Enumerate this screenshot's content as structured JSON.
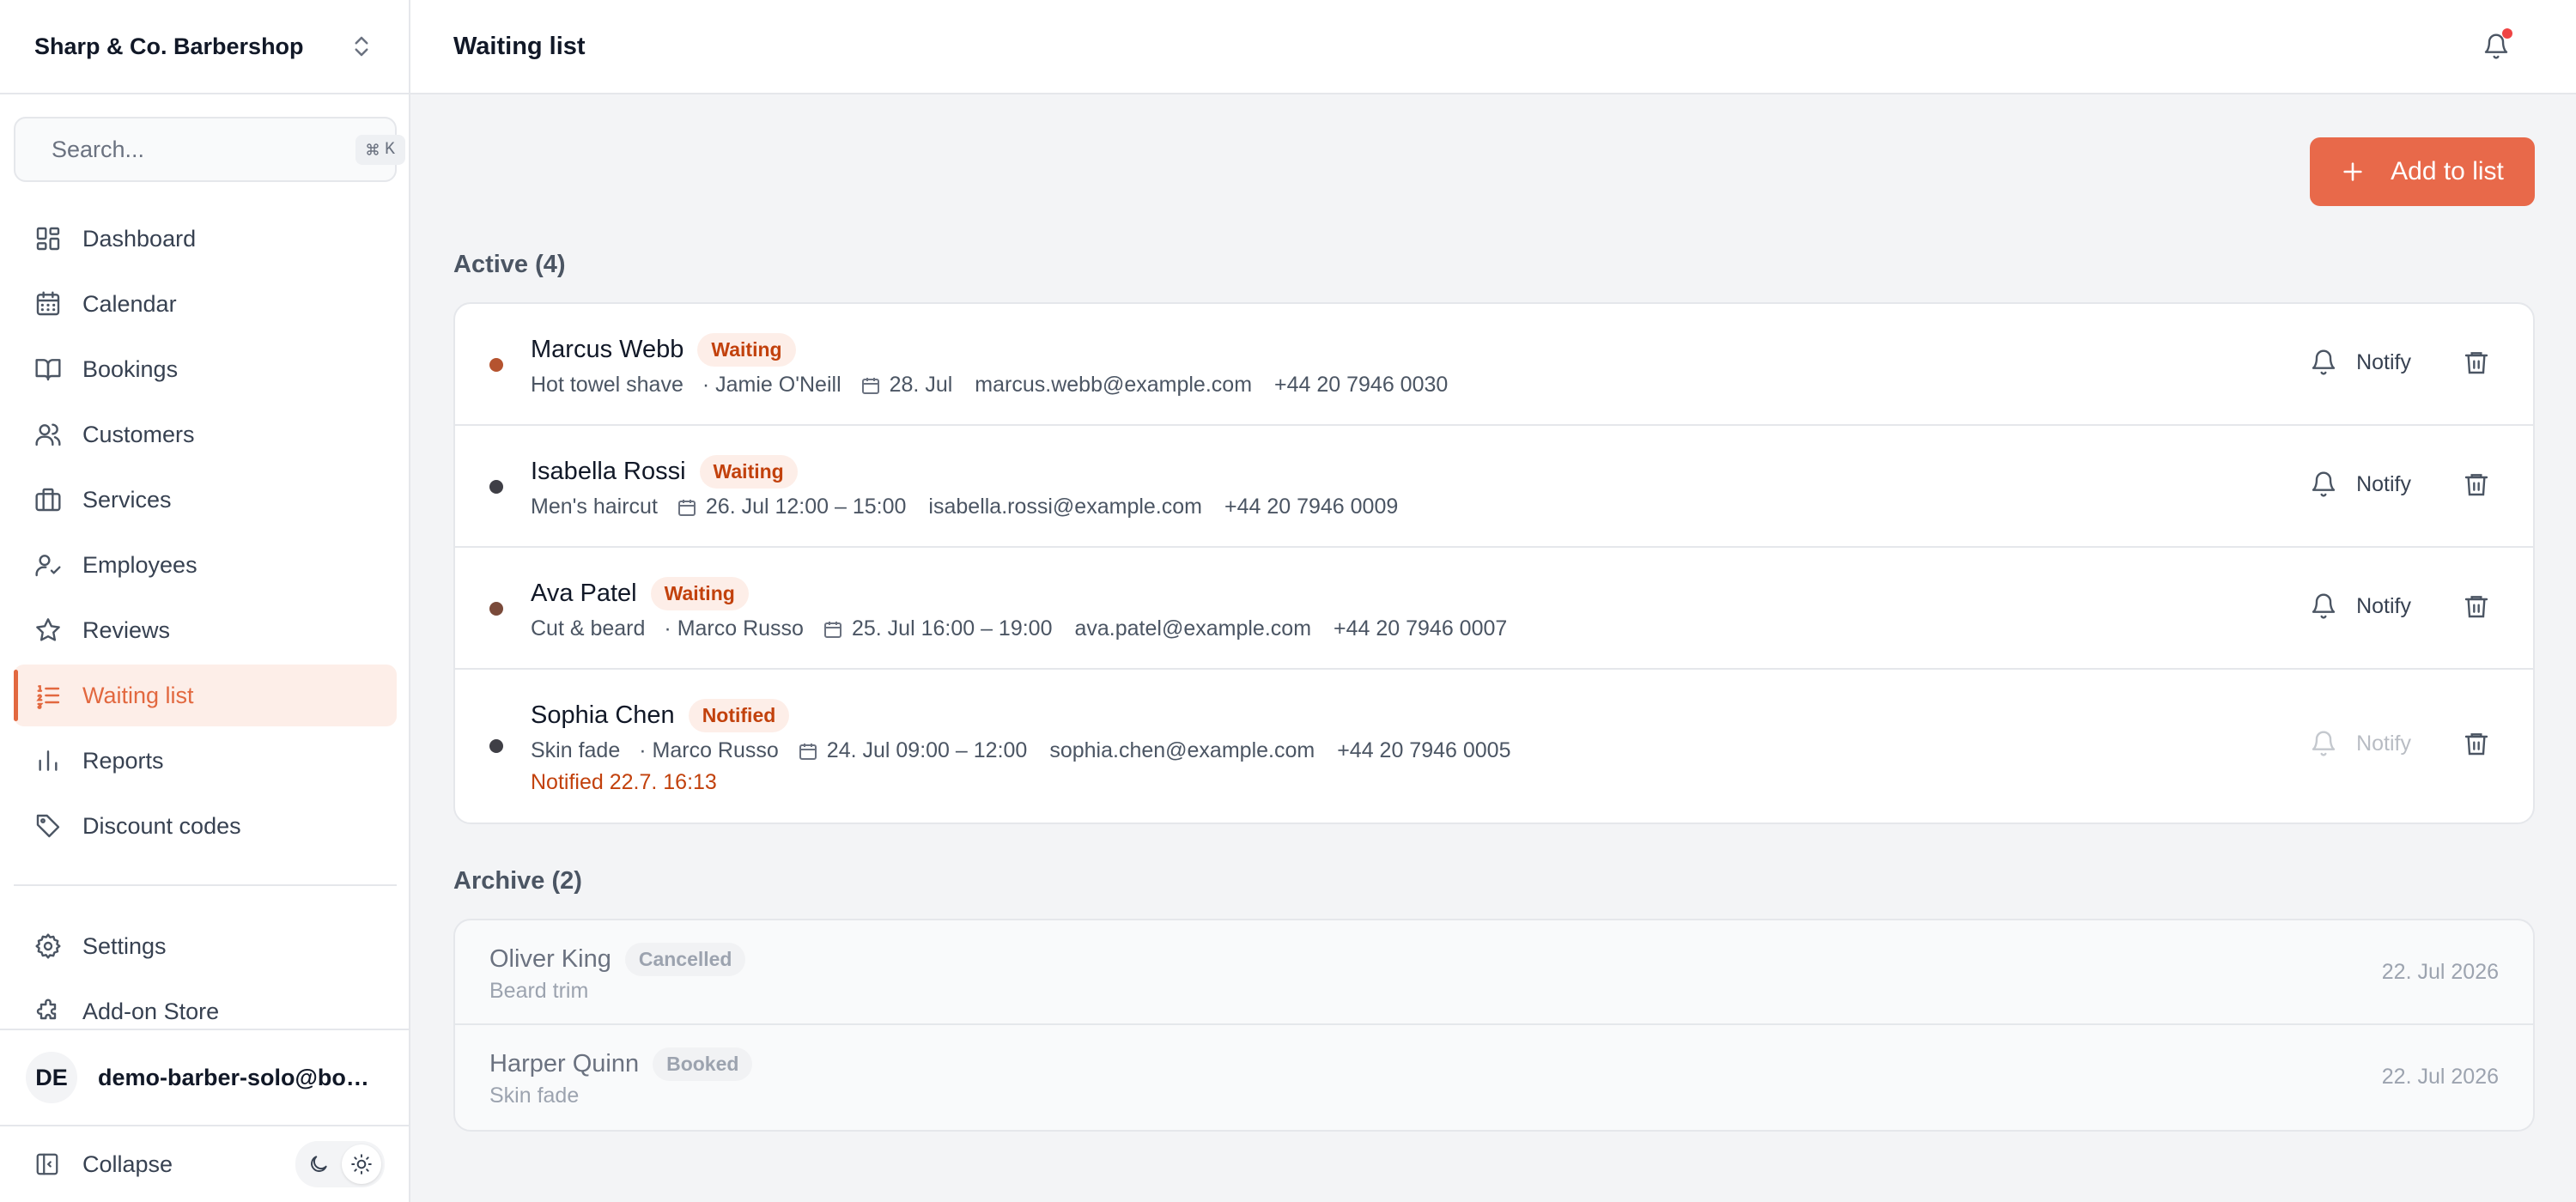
{
  "workspace": {
    "name": "Sharp & Co. Barbershop"
  },
  "search": {
    "placeholder": "Search...",
    "shortcut_key": "K"
  },
  "nav": {
    "items": [
      {
        "label": "Dashboard",
        "icon": "dashboard-icon"
      },
      {
        "label": "Calendar",
        "icon": "calendar-icon"
      },
      {
        "label": "Bookings",
        "icon": "book-icon"
      },
      {
        "label": "Customers",
        "icon": "users-icon"
      },
      {
        "label": "Services",
        "icon": "briefcase-icon"
      },
      {
        "label": "Employees",
        "icon": "user-check-icon"
      },
      {
        "label": "Reviews",
        "icon": "star-icon"
      },
      {
        "label": "Waiting list",
        "icon": "list-ordered-icon",
        "active": true
      },
      {
        "label": "Reports",
        "icon": "bar-chart-icon"
      },
      {
        "label": "Discount codes",
        "icon": "tag-icon"
      }
    ],
    "secondary": [
      {
        "label": "Settings",
        "icon": "gear-icon"
      },
      {
        "label": "Add-on Store",
        "icon": "puzzle-icon"
      }
    ]
  },
  "user": {
    "initials": "DE",
    "email": "demo-barber-solo@booking.example"
  },
  "footer": {
    "collapse_label": "Collapse"
  },
  "header": {
    "title": "Waiting list"
  },
  "toolbar": {
    "add_label": "Add to list"
  },
  "active": {
    "title": "Active (4)",
    "notify_label": "Notify",
    "rows": [
      {
        "name": "Marcus Webb",
        "status": "Waiting",
        "dot_color": "#b5532f",
        "service": "Hot towel shave",
        "employee": "· Jamie O'Neill",
        "date": "28. Jul",
        "email": "marcus.webb@example.com",
        "phone": "+44 20 7946 0030",
        "notified": "",
        "notify_enabled": true
      },
      {
        "name": "Isabella Rossi",
        "status": "Waiting",
        "dot_color": "#3f3f46",
        "service": "Men's haircut",
        "employee": "",
        "date": "26. Jul 12:00 – 15:00",
        "email": "isabella.rossi@example.com",
        "phone": "+44 20 7946 0009",
        "notified": "",
        "notify_enabled": true
      },
      {
        "name": "Ava Patel",
        "status": "Waiting",
        "dot_color": "#7a4a3a",
        "service": "Cut & beard",
        "employee": "· Marco Russo",
        "date": "25. Jul 16:00 – 19:00",
        "email": "ava.patel@example.com",
        "phone": "+44 20 7946 0007",
        "notified": "",
        "notify_enabled": true
      },
      {
        "name": "Sophia Chen",
        "status": "Notified",
        "dot_color": "#3f3f46",
        "service": "Skin fade",
        "employee": "· Marco Russo",
        "date": "24. Jul 09:00 – 12:00",
        "email": "sophia.chen@example.com",
        "phone": "+44 20 7946 0005",
        "notified": "Notified 22.7. 16:13",
        "notify_enabled": false
      }
    ]
  },
  "archive": {
    "title": "Archive (2)",
    "rows": [
      {
        "name": "Oliver King",
        "status": "Cancelled",
        "service": "Beard trim",
        "date": "22. Jul 2026"
      },
      {
        "name": "Harper Quinn",
        "status": "Booked",
        "service": "Skin fade",
        "date": "22. Jul 2026"
      }
    ]
  },
  "colors": {
    "accent": "#e8694a",
    "accent_text": "#c2410c",
    "accent_bg": "#fdeee8"
  }
}
